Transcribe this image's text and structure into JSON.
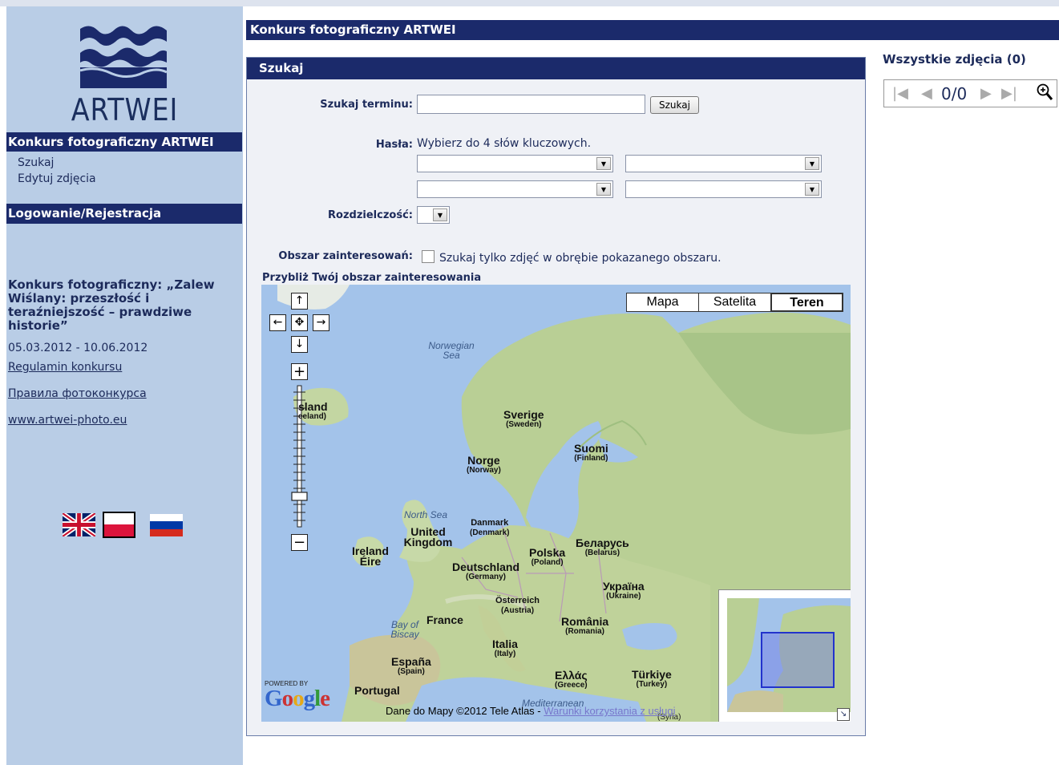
{
  "sidebar": {
    "logo_text": "ARTWEI",
    "section1_title": "Konkurs fotograficzny ARTWEI",
    "links": [
      "Szukaj",
      "Edytuj zdjęcia"
    ],
    "login_title": "Logowanie/Rejestracja",
    "contest_title": "Konkurs fotograficzny: „Zalew Wiślany: przeszłość i teraźniejszość – prawdziwe historie”",
    "contest_dates": "05.03.2012 - 10.06.2012",
    "extra_links": [
      "Regulamin konkursu",
      "Правила фотоконкурса",
      "www.artwei-photo.eu"
    ],
    "flags": [
      "uk-flag",
      "pl-flag",
      "ru-flag"
    ]
  },
  "header": {
    "title": "Konkurs fotograficzny ARTWEI"
  },
  "search": {
    "panel_title": "Szukaj",
    "term_label": "Szukaj terminu:",
    "term_value": "",
    "button_label": "Szukaj",
    "keywords_label": "Hasła:",
    "keywords_help": "Wybierz do 4 słów kluczowych.",
    "resolution_label": "Rozdzielczość:",
    "area_label": "Obszar zainteresowań:",
    "area_checkbox_label": "Szukaj tylko zdjęć w obrębie pokazanego obszaru.",
    "zoom_hint": "Przybliż Twój obszar zainteresowania"
  },
  "map": {
    "types": [
      "Mapa",
      "Satelita",
      "Teren"
    ],
    "selected_type": "Teren",
    "labels": {
      "island": "sland",
      "island_sub": "eeland)",
      "sverige": "Sverige",
      "sverige_sub": "(Sweden)",
      "suomi": "Suomi",
      "suomi_sub": "(Finland)",
      "norge": "Norge",
      "norge_sub": "(Norway)",
      "danmark": "Danmark",
      "danmark_sub": "(Denmark)",
      "uk": "United Kingdom",
      "ireland": "Ireland",
      "eire": "Éire",
      "polska": "Polska",
      "polska_sub": "(Poland)",
      "belarus": "Беларусь",
      "belarus_sub": "(Belarus)",
      "deutschland": "Deutschland",
      "deutschland_sub": "(Germany)",
      "ukraina": "Україна",
      "ukraina_sub": "(Ukraine)",
      "osterreich": "Österreich",
      "osterreich_sub": "(Austria)",
      "france": "France",
      "romania": "România",
      "romania_sub": "(Romania)",
      "italia": "Italia",
      "italia_sub": "(Italy)",
      "espana": "España",
      "espana_sub": "(Spain)",
      "ellas": "Ελλάς",
      "ellas_sub": "(Greece)",
      "turkiye": "Türkiye",
      "turkiye_sub": "(Turkey)",
      "portugal": "Portugal"
    },
    "seas": {
      "norwegian": "Norwegian Sea",
      "north": "North Sea",
      "biscay": "Bay of Biscay",
      "med": "Mediterranean",
      "syria": "(Syria)"
    },
    "powered_by": "POWERED BY",
    "google": "Google",
    "copyright": "Dane do Mapy ©2012 Tele Atlas -",
    "terms_link": "Warunki korzystania z usługi"
  },
  "photos": {
    "title": "Wszystkie zdjęcia (0)",
    "counter": "0/0"
  },
  "colors": {
    "navy": "#1b2a6b",
    "sidebar": "#b9cde6",
    "water": "#a3c3ea",
    "land": "#b9cf95"
  }
}
